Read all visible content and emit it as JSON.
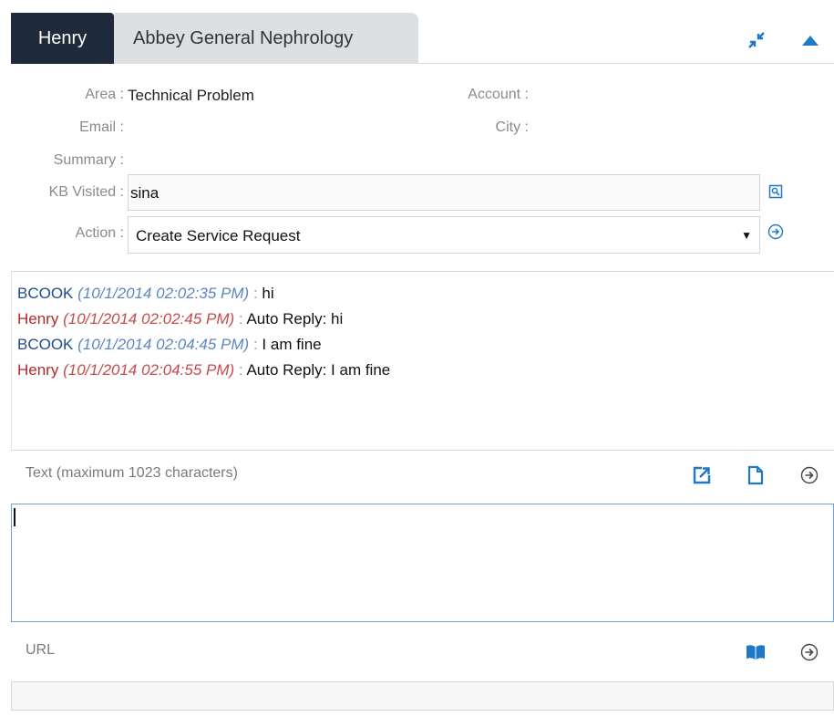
{
  "tabs": [
    {
      "label": "Henry",
      "active": true
    },
    {
      "label": "Abbey General Nephrology",
      "active": false
    }
  ],
  "header_icons": {
    "minimize": "compress-icon",
    "collapse": "collapse-up-icon"
  },
  "form": {
    "area_label": "Area :",
    "area_value": "Technical Problem",
    "account_label": "Account :",
    "account_value": "",
    "email_label": "Email :",
    "email_value": "",
    "city_label": "City :",
    "city_value": "",
    "summary_label": "Summary :",
    "summary_value": "",
    "kb_label": "KB Visited :",
    "kb_value": "sina",
    "action_label": "Action :",
    "action_value": "Create Service Request"
  },
  "transcript": [
    {
      "sender": "BCOOK",
      "time": "(10/1/2014 02:02:35 PM)",
      "sep": ":",
      "text": "hi",
      "kind": "agent"
    },
    {
      "sender": "Henry",
      "time": "(10/1/2014 02:02:45 PM)",
      "sep": ":",
      "text": "Auto Reply: hi",
      "kind": "user"
    },
    {
      "sender": "BCOOK",
      "time": "(10/1/2014 02:04:45 PM)",
      "sep": ":",
      "text": "I am fine",
      "kind": "agent"
    },
    {
      "sender": "Henry",
      "time": "(10/1/2014 02:04:55 PM)",
      "sep": ":",
      "text": "Auto Reply: I am fine",
      "kind": "user"
    }
  ],
  "text_label": "Text (maximum 1023 characters)",
  "text_value": "",
  "url_label": "URL",
  "url_value": "",
  "colors": {
    "accent": "#1f79c8",
    "tab_active": "#1f2a3a",
    "agent": "#1f4c8a",
    "user": "#b22a2a"
  }
}
